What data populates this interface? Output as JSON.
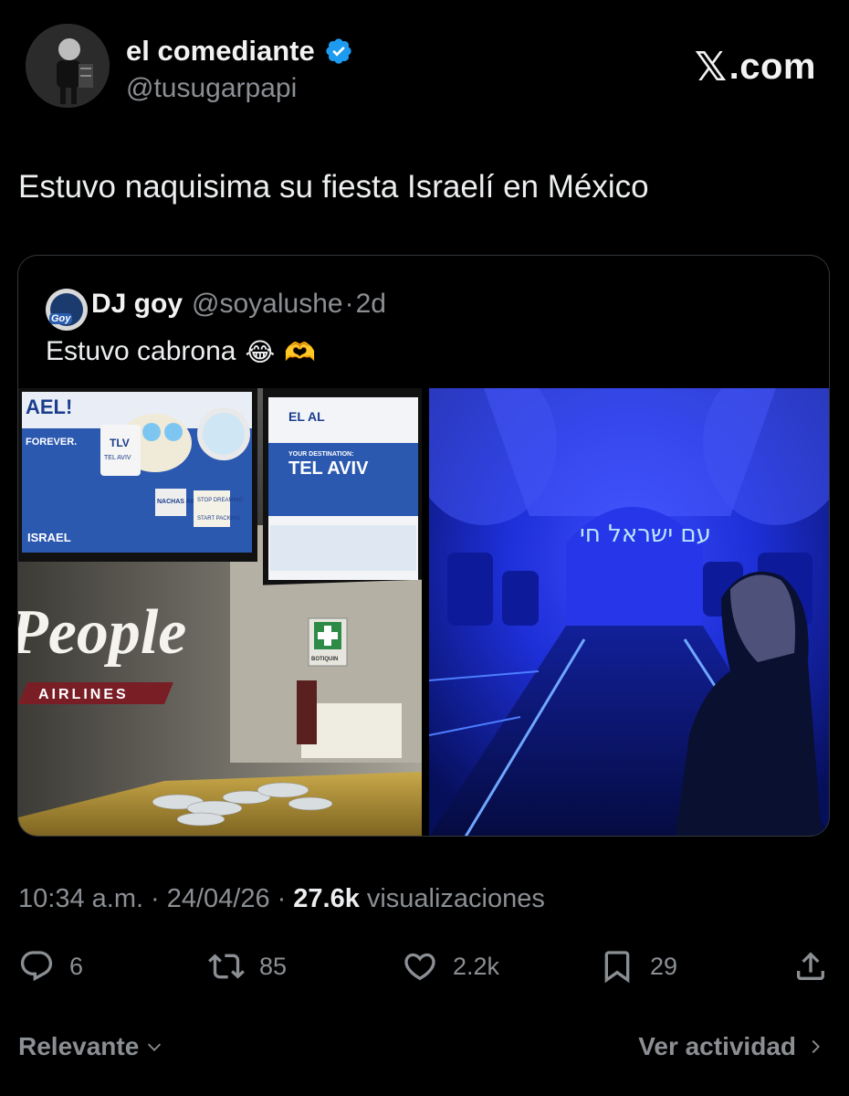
{
  "author": {
    "display_name": "el comediante",
    "handle": "@tusugarpapi",
    "verified": true,
    "verified_color": "#1d9bf0"
  },
  "brand": {
    "logo_x": "𝕏",
    "logo_suffix": ".com"
  },
  "tweet": {
    "text": "Estuvo naquisima su fiesta Israelí en México"
  },
  "quote": {
    "display_name": "DJ goy",
    "handle": "@soyalushe",
    "separator": "·",
    "time": "2d",
    "avatar_text": "Goy",
    "text": "Estuvo cabrona",
    "emojis": [
      "😂",
      "🫶"
    ],
    "images": [
      {
        "name": "airport-counter-photo",
        "poster_left_texts": [
          "AEL!",
          "FOREVER.",
          "TLV",
          "TEL AVIV",
          "NACHAS AIR",
          "STOP DREAMING",
          "START PACKING",
          "ISRAEL"
        ],
        "poster_right_texts": [
          "EL AL",
          "YOUR DESTINATION:",
          "TEL AVIV"
        ],
        "sign_text": "People",
        "sign_subtext": "AIRLINES",
        "sign_box_text": "BOTIQUIN"
      },
      {
        "name": "airplane-cabin-photo",
        "neon_text": "עם ישראל חי"
      }
    ]
  },
  "meta": {
    "time": "10:34 a.m.",
    "sep1": "·",
    "date": "24/04/26",
    "sep2": "·",
    "views_count": "27.6k",
    "views_label": "visualizaciones"
  },
  "actions": {
    "replies": "6",
    "reposts": "85",
    "likes": "2.2k",
    "bookmarks": "29"
  },
  "footer": {
    "sort_label": "Relevante",
    "activity_label": "Ver actividad"
  }
}
